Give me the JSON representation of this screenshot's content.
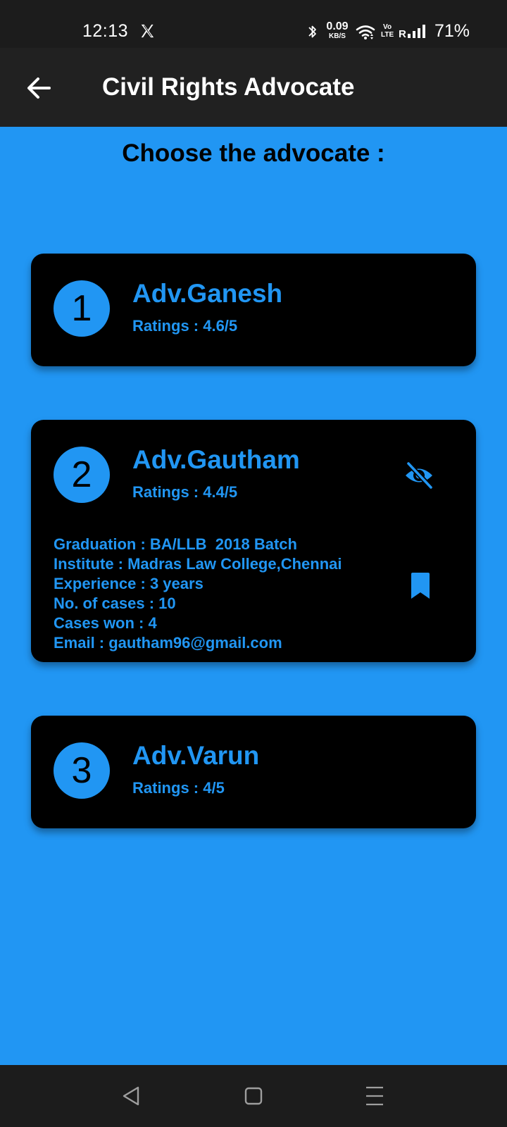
{
  "status_bar": {
    "time": "12:13",
    "net_speed_value": "0.09",
    "net_speed_unit": "KB/S",
    "volte_top": "Vo",
    "volte_bottom": "LTE",
    "battery": "71%"
  },
  "app_bar": {
    "title": "Civil Rights Advocate"
  },
  "main": {
    "heading": "Choose the advocate :",
    "advocates": [
      {
        "number": "1",
        "name": "Adv.Ganesh",
        "rating": "Ratings : 4.6/5"
      },
      {
        "number": "2",
        "name": "Adv.Gautham",
        "rating": "Ratings : 4.4/5",
        "details": [
          "Graduation : BA/LLB  2018 Batch",
          "Institute : Madras Law College,Chennai",
          "Experience : 3 years",
          "No. of cases : 10",
          "Cases won : 4",
          "Email : gautham96@gmail.com"
        ]
      },
      {
        "number": "3",
        "name": "Adv.Varun",
        "rating": "Ratings : 4/5"
      }
    ]
  },
  "icons": {
    "x_logo": "x-logo-icon",
    "bluetooth": "bluetooth-icon",
    "wifi": "wifi-icon",
    "signal": "signal-icon",
    "back": "arrow-left-icon",
    "eye_off": "eye-off-icon",
    "bookmark": "bookmark-icon",
    "nav_back": "triangle-back-icon",
    "nav_home": "square-home-icon",
    "nav_menu": "menu-lines-icon"
  },
  "colors": {
    "background": "#2196f3",
    "accent": "#2196f3",
    "card": "#000000",
    "app_bar": "#212121",
    "status_bar": "#1c1c1c"
  }
}
